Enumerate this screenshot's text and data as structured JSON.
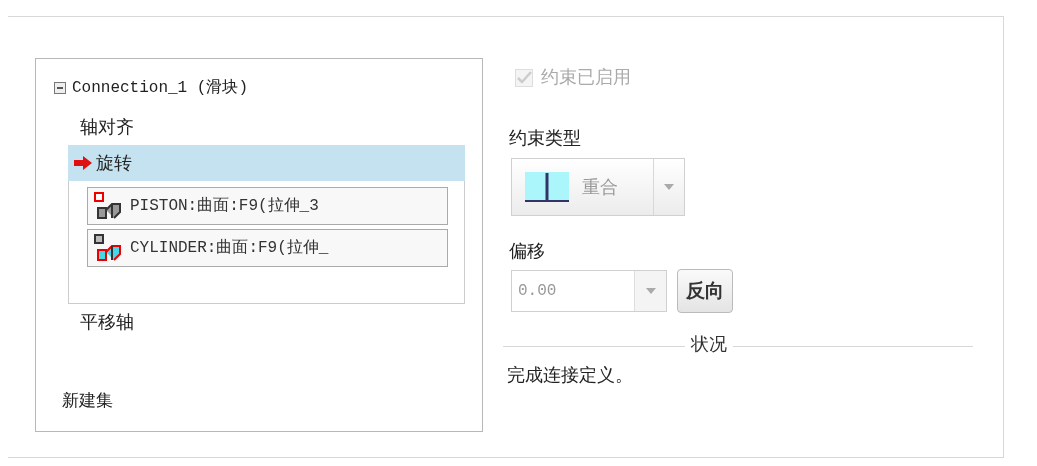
{
  "tree": {
    "label": "Connection_1 (滑块)",
    "expanded": true,
    "children": [
      {
        "label": "轴对齐",
        "selected": false
      },
      {
        "label": "旋转",
        "selected": true,
        "references": [
          {
            "label": "PISTON:曲面:F9(拉伸_3"
          },
          {
            "label": "CYLINDER:曲面:F9(拉伸_"
          }
        ]
      },
      {
        "label": "平移轴",
        "selected": false
      }
    ]
  },
  "new_set": "新建集",
  "constraint_enabled": {
    "label": "约束已启用",
    "checked": true,
    "disabled": true
  },
  "constraint_type": {
    "label": "约束类型",
    "value": "重合"
  },
  "offset": {
    "label": "偏移",
    "value": "0.00",
    "flip_button": "反向"
  },
  "status": {
    "label": "状况",
    "message": "完成连接定义。"
  }
}
